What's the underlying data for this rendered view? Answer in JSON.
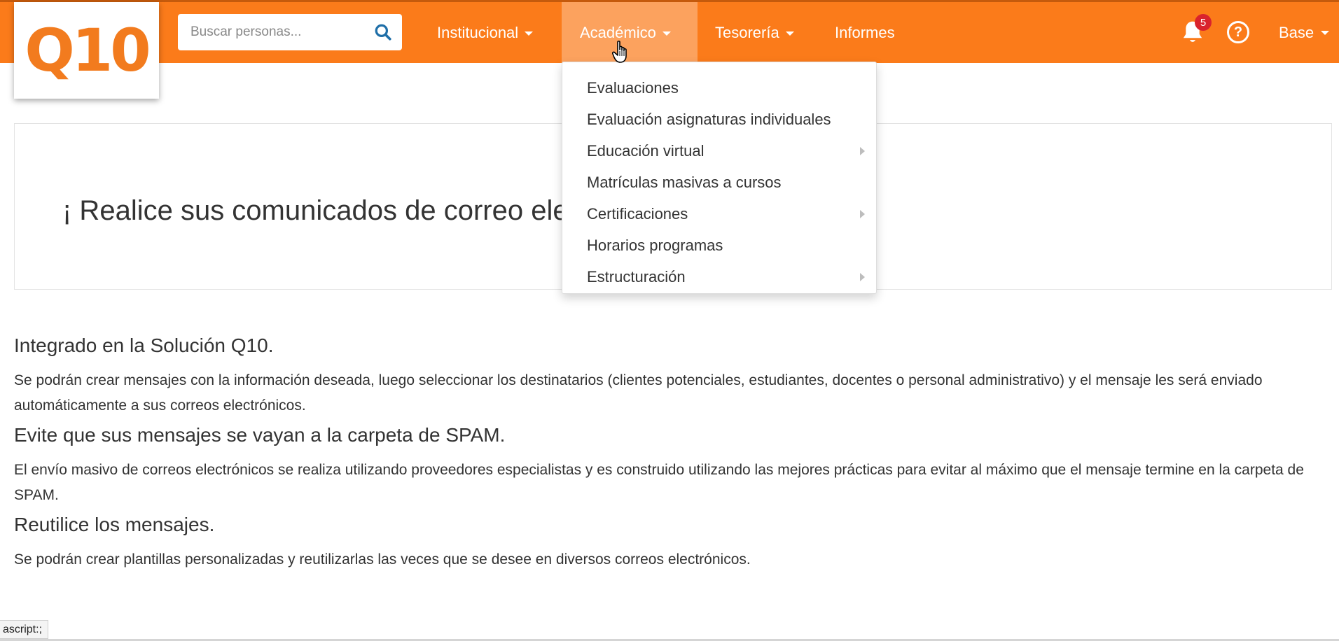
{
  "logo": {
    "text": "Q10"
  },
  "search": {
    "placeholder": "Buscar personas..."
  },
  "nav": {
    "items": [
      {
        "label": "Institucional",
        "has_caret": true
      },
      {
        "label": "Académico",
        "has_caret": true,
        "active": true
      },
      {
        "label": "Tesorería",
        "has_caret": true
      },
      {
        "label": "Informes",
        "has_caret": false
      }
    ],
    "notifications_count": "5",
    "help_icon": "?",
    "user_label": "Base"
  },
  "dropdown": {
    "items": [
      {
        "label": "Evaluaciones",
        "submenu": false
      },
      {
        "label": "Evaluación asignaturas individuales",
        "submenu": false
      },
      {
        "label": "Educación virtual",
        "submenu": true
      },
      {
        "label": "Matrículas masivas a cursos",
        "submenu": false
      },
      {
        "label": "Certificaciones",
        "submenu": true
      },
      {
        "label": "Horarios programas",
        "submenu": false
      },
      {
        "label": "Estructuración",
        "submenu": true
      }
    ]
  },
  "banner": {
    "title": "¡ Realice sus comunicados de correo ele"
  },
  "sections": [
    {
      "heading": "Integrado en la Solución Q10.",
      "text": "Se podrán crear mensajes con la información deseada, luego seleccionar los destinatarios (clientes potenciales, estudiantes, docentes o personal administrativo) y el mensaje les será enviado automáticamente a sus correos electrónicos."
    },
    {
      "heading": "Evite que sus mensajes se vayan a la carpeta de SPAM.",
      "text": "El envío masivo de correos electrónicos se realiza utilizando proveedores especialistas y es construido utilizando las mejores prácticas para evitar al máximo que el mensaje termine en la carpeta de SPAM."
    },
    {
      "heading": "Reutilice los mensajes.",
      "text": "Se podrán crear plantillas personalizadas y reutilizarlas las veces que se desee en diversos correos electrónicos."
    }
  ],
  "status_bar": {
    "text": "ascript:;"
  },
  "colors": {
    "brand": "#fb7b1a",
    "active_nav": "#fca25e",
    "badge": "#d9232d"
  },
  "icons": [
    "search-icon",
    "bell-icon",
    "help-icon",
    "caret-down-icon",
    "submenu-arrow-icon",
    "hand-cursor-icon"
  ]
}
